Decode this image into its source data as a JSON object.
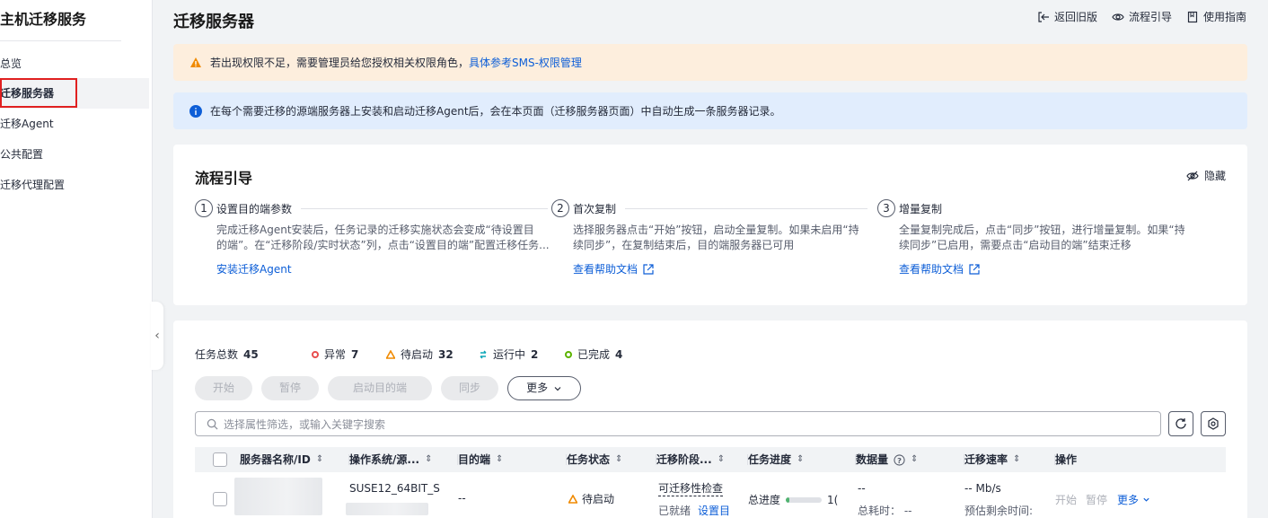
{
  "sidebar": {
    "title": "主机迁移服务",
    "items": [
      {
        "label": "总览"
      },
      {
        "label": "迁移服务器"
      },
      {
        "label": "迁移Agent"
      },
      {
        "label": "公共配置"
      },
      {
        "label": "迁移代理配置"
      }
    ]
  },
  "header": {
    "title": "迁移服务器",
    "links": [
      {
        "label": "返回旧版",
        "icon": "exit-icon"
      },
      {
        "label": "流程引导",
        "icon": "eye-icon"
      },
      {
        "label": "使用指南",
        "icon": "book-icon"
      }
    ]
  },
  "alerts": {
    "warning_text": "若出现权限不足，需要管理员给您授权相关权限角色，",
    "warning_link": "具体参考SMS-权限管理",
    "info_text": "在每个需要迁移的源端服务器上安装和启动迁移Agent后，会在本页面（迁移服务器页面）中自动生成一条服务器记录。"
  },
  "guide": {
    "title": "流程引导",
    "hide_label": "隐藏",
    "steps": [
      {
        "num": "1",
        "title": "设置目的端参数",
        "desc1": "完成迁移Agent安装后，任务记录的迁移实施状态会变成“待设置目",
        "desc2": "的端”。在“迁移阶段/实时状态”列，点击“设置目的端”配置迁移任务...",
        "link": "安装迁移Agent"
      },
      {
        "num": "2",
        "title": "首次复制",
        "desc1": "选择服务器点击“开始”按钮，启动全量复制。如果未启用“持",
        "desc2": "续同步”，在复制结束后，目的端服务器已可用",
        "link": "查看帮助文档"
      },
      {
        "num": "3",
        "title": "增量复制",
        "desc1": "全量复制完成后，点击“同步”按钮，进行增量复制。如果“持",
        "desc2": "续同步”已启用，需要点击“启动目的端”结束迁移",
        "link": "查看帮助文档"
      }
    ]
  },
  "summary": {
    "total_label": "任务总数",
    "total": "45",
    "error_label": "异常",
    "error": "7",
    "pending_label": "待启动",
    "pending": "32",
    "running_label": "运行中",
    "running": "2",
    "done_label": "已完成",
    "done": "4"
  },
  "actions": {
    "start": "开始",
    "pause": "暂停",
    "start_target": "启动目的端",
    "sync": "同步",
    "more": "更多"
  },
  "search": {
    "placeholder": "选择属性筛选，或输入关键字搜索"
  },
  "table": {
    "headers": [
      "服务器名称/ID",
      "操作系统/源...",
      "目的端",
      "任务状态",
      "迁移阶段...",
      "任务进度",
      "数据量",
      "迁移速率",
      "操作"
    ],
    "row": {
      "os": "SUSE12_64BIT_S",
      "target": "--",
      "status": "待启动",
      "stage": "可迁移性检查",
      "stage_state": "已就绪",
      "stage_action": "设置目",
      "progress_label": "总进度",
      "progress_value": "1(",
      "progress_fraction": 0.1,
      "data_amount": "--",
      "elapsed_label": "总耗时：",
      "elapsed": "--",
      "speed": "-- Mb/s",
      "remaining_label": "预估剩余时间:",
      "op_start": "开始",
      "op_pause": "暂停",
      "op_more": "更多"
    }
  },
  "colors": {
    "primary": "#0d5ed7",
    "error": "#e84e4e",
    "warning": "#f08a00",
    "running": "#0aa5b7",
    "success": "#5cb300"
  }
}
